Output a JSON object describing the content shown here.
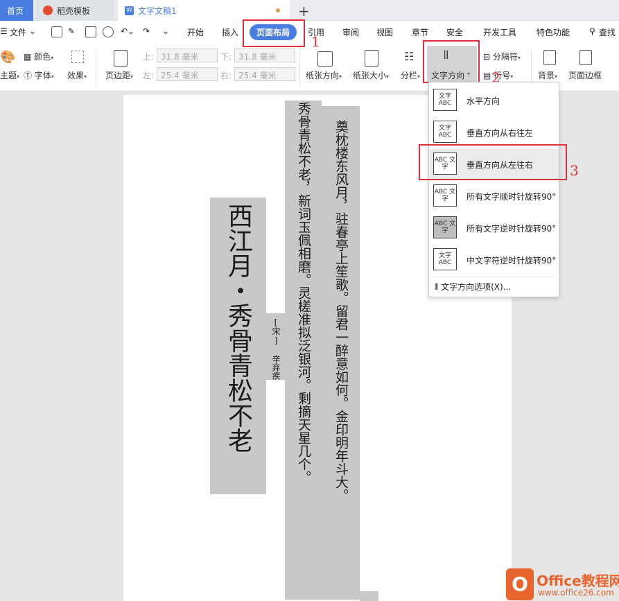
{
  "tabs": {
    "home": "首页",
    "daoke": "稻壳模板",
    "doc": "文字文稿1",
    "plus": "+"
  },
  "menu": {
    "file": "文件",
    "items": [
      "开始",
      "插入",
      "页面布局",
      "引用",
      "审阅",
      "视图",
      "章节",
      "安全",
      "开发工具",
      "特色功能"
    ],
    "active": "页面布局",
    "search": "查找"
  },
  "ribbon": {
    "theme": "主题",
    "color": "颜色",
    "font": "字体",
    "effect": "效果",
    "margins": "页边距",
    "top_label": "上:",
    "bottom_label": "下:",
    "left_label": "左:",
    "right_label": "右:",
    "top_val": "31.8 毫米",
    "bottom_val": "31.8 毫米",
    "left_val": "25.4 毫米",
    "right_val": "25.4 毫米",
    "orientation": "纸张方向",
    "size": "纸张大小",
    "columns": "分栏",
    "text_direction": "文字方向",
    "separator": "分隔符",
    "line_num": "行号",
    "background": "背景",
    "page_border": "页面边框"
  },
  "document": {
    "title": "西江月・秀骨青松不老",
    "author": "[宋] 辛弃疾",
    "line1": "秀骨青松不老，新词玉佩相磨。灵槎准拟泛银河。剩摘天星几个。",
    "line2": "奠枕楼东风月，驻春亭上笙歌。留君一醉意如何。金印明年斗大。",
    "line2_top": "奠"
  },
  "dropdown": {
    "items": [
      {
        "label": "水平方向",
        "icon_text": "文字 ABC"
      },
      {
        "label": "垂直方向从右往左",
        "icon_text": "文字 ABC"
      },
      {
        "label": "垂直方向从左往右",
        "icon_text": "ABC 文字"
      },
      {
        "label": "所有文字顺时针旋转90°",
        "icon_text": "ABC 文字"
      },
      {
        "label": "所有文字逆时针旋转90°",
        "icon_text": "ABC 文字"
      },
      {
        "label": "中文字符逆时针旋转90°",
        "icon_text": "文字 ABC"
      }
    ],
    "options": "文字方向选项(X)..."
  },
  "annotations": {
    "n1": "1",
    "n2": "2",
    "n3": "3"
  },
  "logo": {
    "badge": "O",
    "title": "Office教程网",
    "url": "www.office26.com"
  },
  "colors": {
    "accent": "#4a7de2",
    "annotation": "#e0313b",
    "logo": "#e8642c",
    "highlight": "#c8c8c8"
  }
}
